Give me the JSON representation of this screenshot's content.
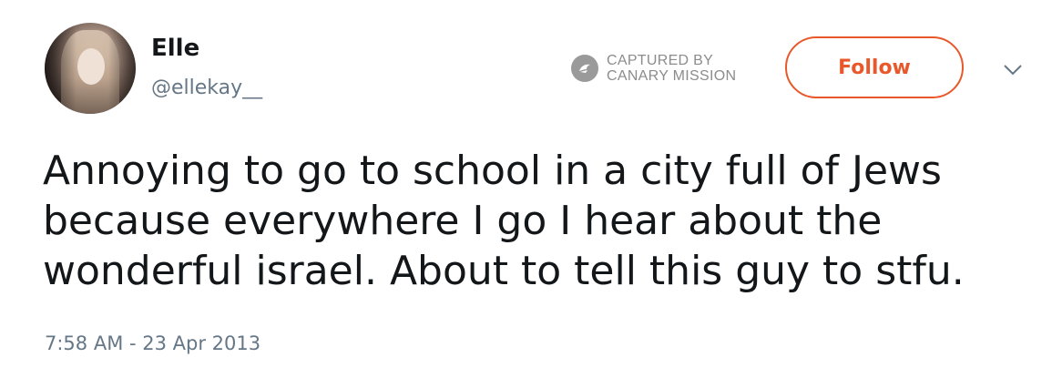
{
  "tweet": {
    "author": {
      "display_name": "Elle",
      "handle": "@ellekay__"
    },
    "captured_badge": {
      "line1": "CAPTURED BY",
      "line2": "CANARY MISSION",
      "icon": "canary-bird-icon"
    },
    "follow_label": "Follow",
    "menu_icon": "chevron-down-icon",
    "text": "Annoying to go to school in a city full of Jews because everywhere I go I hear about the wonderful israel. About to tell this guy to stfu.",
    "timestamp": "7:58 AM - 23 Apr 2013"
  },
  "colors": {
    "accent": "#e8582a",
    "text": "#14171a",
    "secondary_text": "#657786",
    "badge_gray": "#8c8c8c"
  }
}
